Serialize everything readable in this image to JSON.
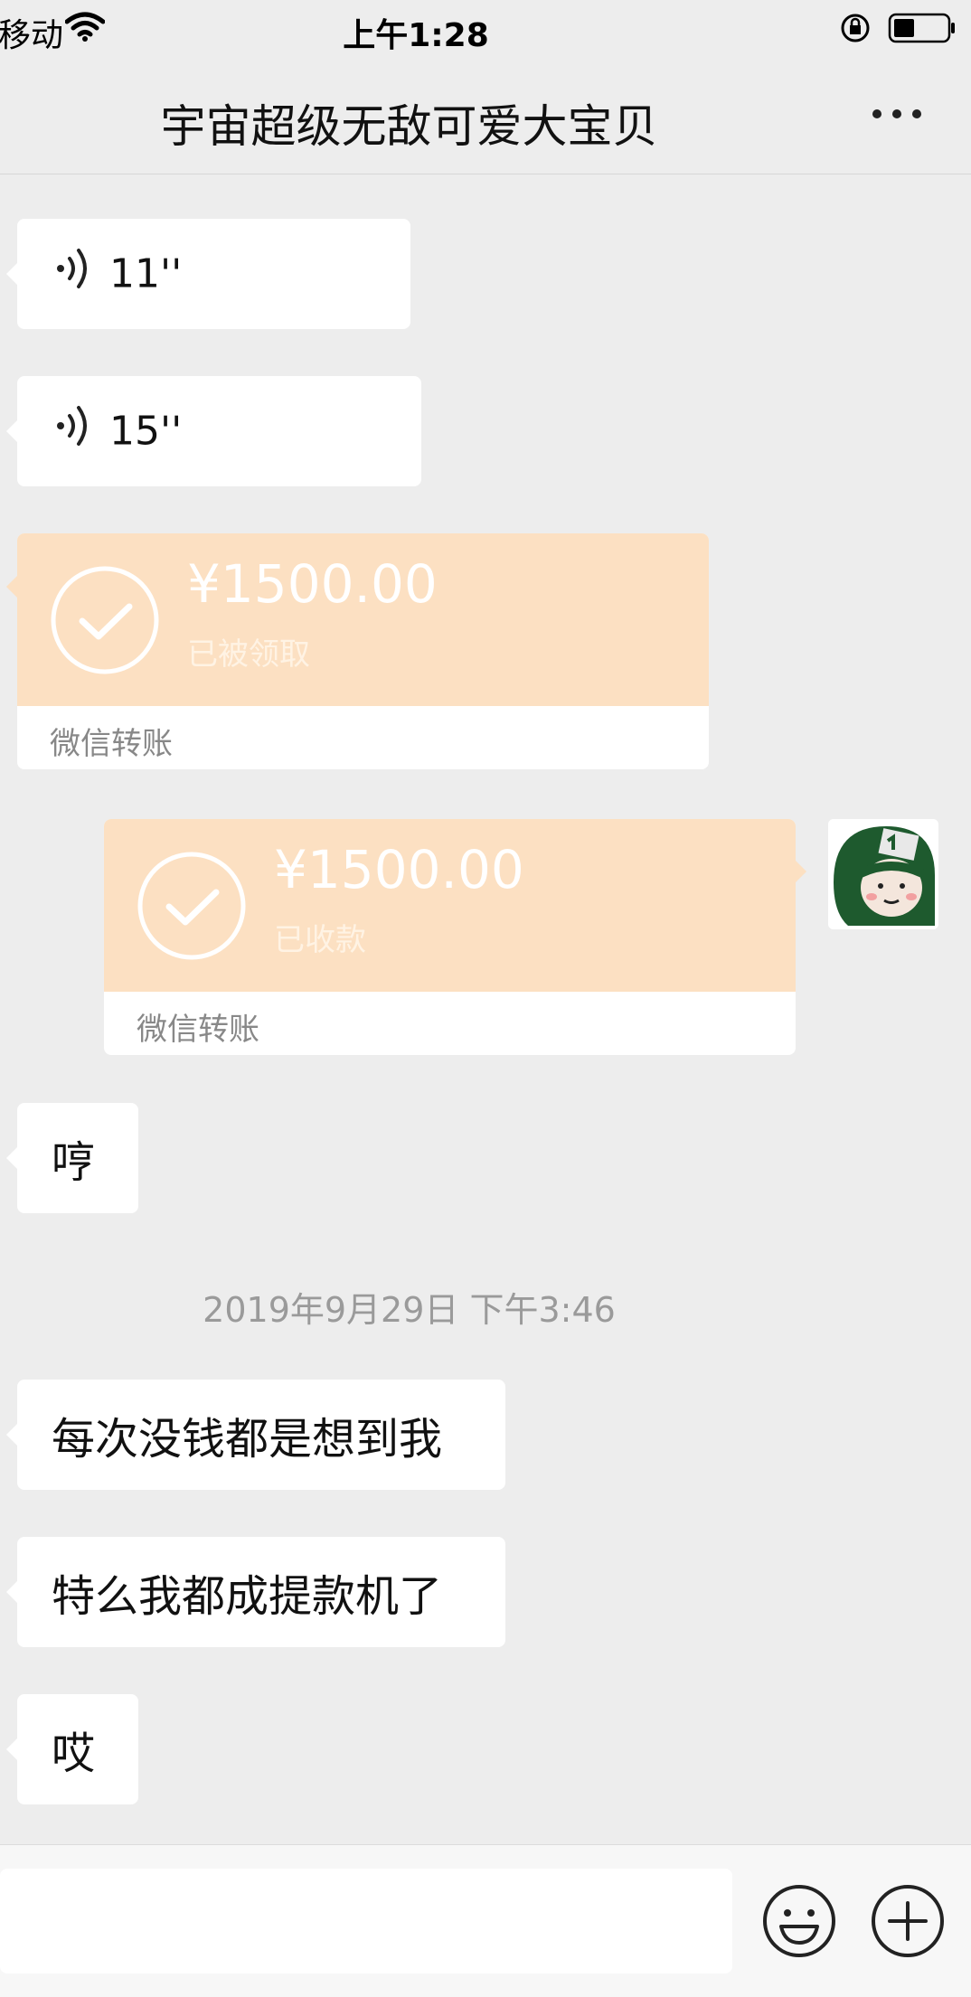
{
  "status_bar": {
    "carrier": "移动",
    "time": "上午1:28"
  },
  "nav": {
    "title": "宇宙超级无敌可爱大宝贝",
    "more_label": "•••"
  },
  "messages": [
    {
      "type": "voice",
      "direction": "incoming",
      "duration": "11''"
    },
    {
      "type": "voice",
      "direction": "incoming",
      "duration": "15''"
    },
    {
      "type": "transfer",
      "direction": "incoming",
      "amount": "¥1500.00",
      "status": "已被领取",
      "label": "微信转账"
    },
    {
      "type": "transfer",
      "direction": "outgoing",
      "amount": "¥1500.00",
      "status": "已收款",
      "label": "微信转账"
    },
    {
      "type": "text",
      "direction": "incoming",
      "text": "哼"
    },
    {
      "type": "timestamp",
      "text": "2019年9月29日 下午3:46"
    },
    {
      "type": "text",
      "direction": "incoming",
      "text": "每次没钱都是想到我"
    },
    {
      "type": "text",
      "direction": "incoming",
      "text": "特么我都成提款机了"
    },
    {
      "type": "text",
      "direction": "incoming",
      "text": "哎"
    }
  ],
  "composer": {
    "input_value": ""
  },
  "colors": {
    "background": "#ededed",
    "bubble": "#ffffff",
    "transfer": "#fce0c2",
    "avatar_green": "#1e5a2e"
  },
  "icons": {
    "wifi": "wifi-icon",
    "lock": "rotation-lock-icon",
    "battery": "battery-icon",
    "more": "more-icon",
    "voice": "voice-icon",
    "check": "check-circle-icon",
    "emoji": "emoji-icon",
    "plus": "plus-icon"
  }
}
